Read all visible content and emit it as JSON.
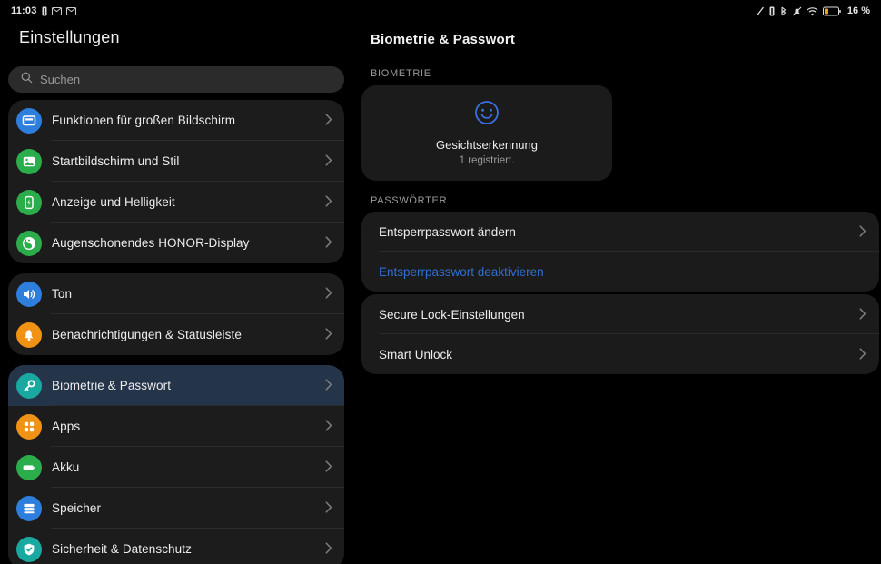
{
  "statusbar": {
    "time": "11:03",
    "left_icons": [
      "battery-small-icon",
      "message-icon",
      "message-icon"
    ],
    "right_icons": [
      "vpn-slash-icon",
      "battery-small-icon",
      "bluetooth-icon",
      "mute-bell-icon",
      "wifi-icon",
      "battery-icon"
    ],
    "battery_percent": "16 %"
  },
  "sidebar": {
    "title": "Einstellungen",
    "search": {
      "placeholder": "Suchen",
      "value": "",
      "icon": "search-icon"
    },
    "groups": [
      {
        "items": [
          {
            "label": "Funktionen für großen Bildschirm",
            "icon": "large-screen-icon",
            "color": "#2e7ede",
            "selected": false
          },
          {
            "label": "Startbildschirm und Stil",
            "icon": "home-screen-icon",
            "color": "#2bad4b",
            "selected": false
          },
          {
            "label": "Anzeige und Helligkeit",
            "icon": "brightness-icon",
            "color": "#2bad4b",
            "selected": false
          },
          {
            "label": "Augenschonendes HONOR-Display",
            "icon": "eye-comfort-icon",
            "color": "#2bad4b",
            "selected": false
          }
        ]
      },
      {
        "items": [
          {
            "label": "Ton",
            "icon": "sound-icon",
            "color": "#2e7ede",
            "selected": false
          },
          {
            "label": "Benachrichtigungen & Statusleiste",
            "icon": "bell-icon",
            "color": "#f09214",
            "selected": false
          }
        ]
      },
      {
        "items": [
          {
            "label": "Biometrie & Passwort",
            "icon": "key-icon",
            "color": "#1aa9a0",
            "selected": true
          },
          {
            "label": "Apps",
            "icon": "apps-grid-icon",
            "color": "#f09214",
            "selected": false
          },
          {
            "label": "Akku",
            "icon": "battery-icon",
            "color": "#2bad4b",
            "selected": false
          },
          {
            "label": "Speicher",
            "icon": "storage-icon",
            "color": "#2e7ede",
            "selected": false
          },
          {
            "label": "Sicherheit & Datenschutz",
            "icon": "shield-check-icon",
            "color": "#1aa9a0",
            "selected": false
          }
        ]
      }
    ]
  },
  "content": {
    "title": "Biometrie & Passwort",
    "biometrics_header": "BIOMETRIE",
    "biometrics_card": {
      "icon": "face-smile-icon",
      "name": "Gesichtserkennung",
      "sub": "1 registriert."
    },
    "passwords_header": "PASSWÖRTER",
    "password_rows": [
      {
        "label": "Entsperrpasswort ändern",
        "chevron": true,
        "link": false
      },
      {
        "label": "Entsperrpasswort deaktivieren",
        "chevron": false,
        "link": true
      }
    ],
    "lock_rows": [
      {
        "label": "Secure Lock-Einstellungen",
        "chevron": true,
        "link": false
      },
      {
        "label": "Smart Unlock",
        "chevron": true,
        "link": false
      }
    ]
  },
  "colors": {
    "accent_blue": "#2f6fd0",
    "selected_row": "#24354a",
    "card_bg": "#1b1b1b",
    "page_bg": "#000000",
    "face_icon": "#3a6fe0"
  }
}
